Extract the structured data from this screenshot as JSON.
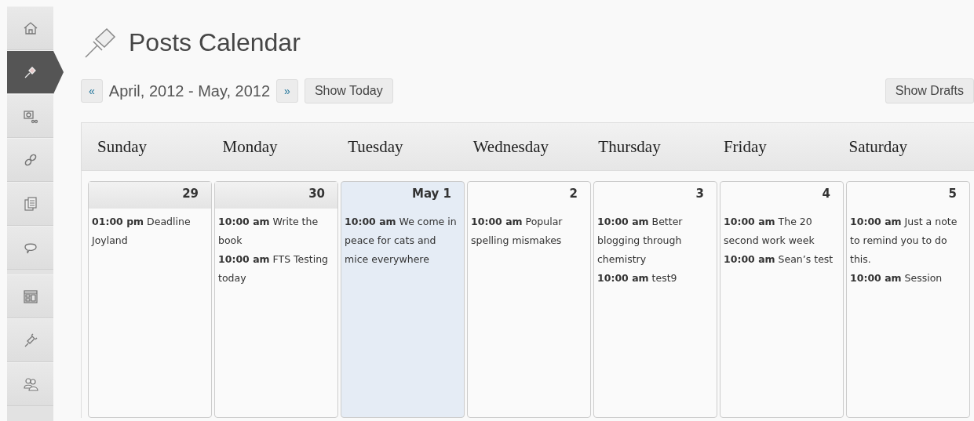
{
  "sidebar": {
    "items": [
      {
        "selected": false
      },
      {
        "selected": true
      },
      {
        "selected": false
      },
      {
        "selected": false
      },
      {
        "selected": false
      },
      {
        "selected": false
      },
      {
        "selected": false
      },
      {
        "selected": false
      },
      {
        "selected": false
      }
    ]
  },
  "page_title": "Posts Calendar",
  "nav": {
    "prev": "«",
    "range": "April, 2012 - May, 2012",
    "next": "»",
    "today_button": "Show Today",
    "drafts_button": "Show Drafts"
  },
  "weekdays": [
    "Sunday",
    "Monday",
    "Tuesday",
    "Wednesday",
    "Thursday",
    "Friday",
    "Saturday"
  ],
  "days": [
    {
      "date": "29",
      "kind": "past",
      "posts": [
        {
          "time": "01:00 pm",
          "title": "Deadline Joyland"
        }
      ]
    },
    {
      "date": "30",
      "kind": "past",
      "posts": [
        {
          "time": "10:00 am",
          "title": "Write the book"
        },
        {
          "time": "10:00 am",
          "title": "FTS Testing today"
        }
      ]
    },
    {
      "date": "May 1",
      "kind": "today",
      "posts": [
        {
          "time": "10:00 am",
          "title": "We come in peace for cats and mice everywhere"
        }
      ]
    },
    {
      "date": "2",
      "kind": "future",
      "posts": [
        {
          "time": "10:00 am",
          "title": "Popular spelling mismakes"
        }
      ]
    },
    {
      "date": "3",
      "kind": "future",
      "posts": [
        {
          "time": "10:00 am",
          "title": "Better blogging through chemistry"
        },
        {
          "time": "10:00 am",
          "title": "test9"
        }
      ]
    },
    {
      "date": "4",
      "kind": "future",
      "posts": [
        {
          "time": "10:00 am",
          "title": "The 20 second work week"
        },
        {
          "time": "10:00 am",
          "title": "Sean’s test"
        }
      ]
    },
    {
      "date": "5",
      "kind": "future",
      "posts": [
        {
          "time": "10:00 am",
          "title": "Just a note to remind you to do this."
        },
        {
          "time": "10:00 am",
          "title": "Session"
        }
      ]
    }
  ]
}
